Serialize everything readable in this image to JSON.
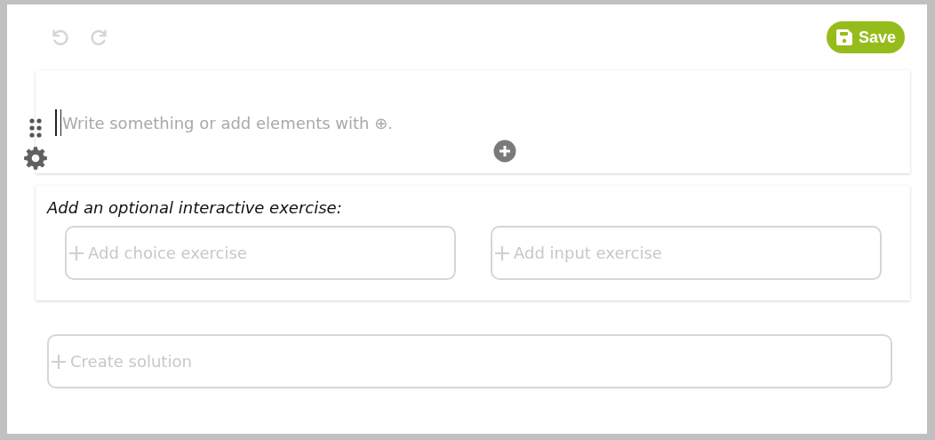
{
  "toolbar": {
    "undo": {
      "disabled": true
    },
    "redo": {
      "disabled": true
    },
    "save": {
      "label": "Save"
    }
  },
  "editor": {
    "placeholder": "Write something or add elements with ⊕."
  },
  "exercise": {
    "title": "Add an optional interactive exercise:",
    "options": [
      {
        "label": "Add choice exercise"
      },
      {
        "label": "Add input exercise"
      }
    ]
  },
  "solution": {
    "label": "Create solution"
  }
}
